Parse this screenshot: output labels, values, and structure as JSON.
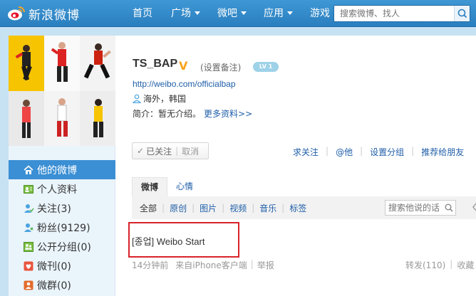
{
  "topbar": {
    "logo_text": "新浪微博",
    "nav": [
      {
        "label": "首页",
        "has_caret": false
      },
      {
        "label": "广场",
        "has_caret": true
      },
      {
        "label": "微吧",
        "has_caret": true
      },
      {
        "label": "应用",
        "has_caret": true
      },
      {
        "label": "游戏",
        "has_caret": true
      }
    ],
    "search_placeholder": "搜索微博、找人"
  },
  "sidebar": {
    "menu": [
      {
        "label": "他的微博",
        "icon": "home-icon",
        "active": true
      },
      {
        "label": "个人资料",
        "icon": "profile-card-icon",
        "active": false
      },
      {
        "label": "关注(3)",
        "icon": "follow-icon",
        "active": false
      },
      {
        "label": "粉丝(9129)",
        "icon": "fans-icon",
        "active": false
      },
      {
        "label": "公开分组(0)",
        "icon": "group-icon",
        "active": false
      },
      {
        "label": "微刊(0)",
        "icon": "magazine-icon",
        "active": false
      },
      {
        "label": "微群(0)",
        "icon": "weiqun-icon",
        "active": false
      }
    ]
  },
  "profile": {
    "username": "TS_BAP",
    "verified_mark": "V",
    "remark": "(设置备注)",
    "level": "LV 1",
    "url": "http://weibo.com/officialbap",
    "location": "海外，韩国",
    "intro_label": "简介：暂无介绍。",
    "more_link": "更多资料>>",
    "followed_label": "已关注",
    "unfollow_label": "取消",
    "actions": [
      "求关注",
      "@他",
      "设置分组",
      "推荐给朋友"
    ]
  },
  "tabs": [
    "微博",
    "心情"
  ],
  "filters": [
    "全部",
    "原创",
    "图片",
    "视频",
    "音乐",
    "标签"
  ],
  "filter_search_placeholder": "搜索他说的话",
  "post": {
    "text": "[종업] Weibo Start",
    "time": "14分钟前",
    "source": "来自iPhone客户端",
    "report": "举报",
    "repost": "转发(110)",
    "favorite": "收藏"
  },
  "colors": {
    "accent": "#3b8fd4",
    "topbar": "#2a7fbf",
    "link": "#1f5ea8",
    "highlight_box": "#d8232a",
    "verified": "#f9a21a"
  }
}
